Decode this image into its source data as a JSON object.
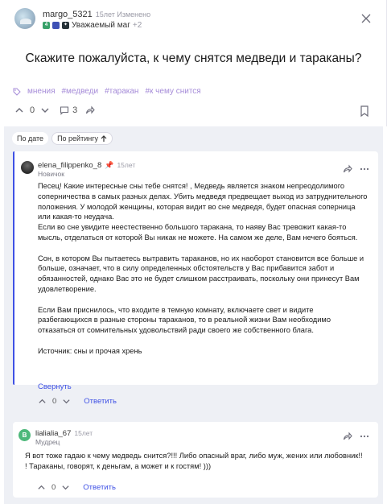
{
  "question": {
    "username": "margo_5321",
    "meta": "15лет Изменено",
    "rank": "Уважаемый маг",
    "rank_extra": "+2",
    "title": "Скажите пожалуйста, к чему снятся медведи и тараканы?",
    "tags": [
      "мнения",
      "#медведи",
      "#таракан",
      "#к чему снится"
    ],
    "votes": "0",
    "comments": "3"
  },
  "sort": {
    "by_date": "По дате",
    "by_rating": "По рейтингу"
  },
  "answers": [
    {
      "username": "elena_filippenko_8",
      "date": "15лет",
      "rank": "Новичок",
      "text": "Песец! Какие интересные сны тебе снятся! , Медведь является знаком непреодолимого соперничества в самых разных делах. Убить медведя предвещает выход из затруднительного положения. У молодой женщины, которая видит во сне медведя, будет опасная соперница или какая-то неудача.\nЕсли во сне увидите неестественно большого таракана, то наяву Вас тревожит какая-то мысль, отделаться от которой Вы никак не можете. На самом же деле, Вам нечего бояться.\n\nСон, в котором Вы пытаетесь вытравить тараканов, но их наоборот становится все больше и больше, означает, что в силу определенных обстоятельств у Вас прибавится забот и обязанностей, однако Вас это не будет слишком расстраивать, поскольку они принесут Вам удовлетворение.\n\nЕсли Вам приснилось, что входите в темную комнату, включаете свет и видите разбегающихся в разные стороны тараканов, то в реальной жизни Вам необходимо отказаться от сомнительных удовольствий ради своего же собственного блага.\n\nИсточник: сны и прочая хрень",
      "collapse": "Свернуть",
      "votes": "0",
      "reply": "Ответить"
    },
    {
      "username": "lialialia_67",
      "avatar_letter": "B",
      "date": "15лет",
      "rank": "Мудрец",
      "text": "Я вот тоже гадаю к чему медведь снится?!!! Либо опасный враг, либо муж, жених или любовник!! ! Тараканы, говорят, к деньгам, а может и к гостям! )))",
      "votes": "0",
      "reply": "Ответить"
    }
  ],
  "colors": {
    "accent": "#3f51e5",
    "tag": "#a58bd8",
    "panel_bg": "#eef0f5"
  }
}
